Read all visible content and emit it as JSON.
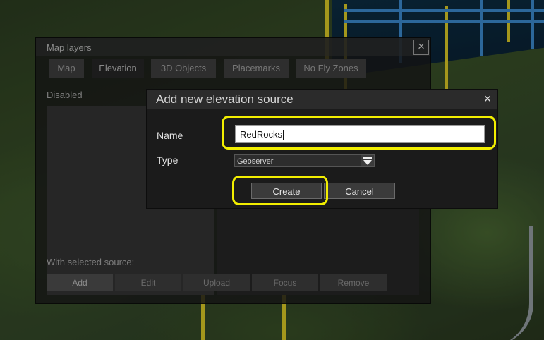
{
  "colors": {
    "highlight": "#f2ee00",
    "pole_yellow": "#e3d228",
    "pole_blue": "#3d8fd6"
  },
  "map_layers": {
    "title": "Map layers",
    "close_icon": "×",
    "tabs": [
      {
        "label": "Map",
        "active": false
      },
      {
        "label": "Elevation",
        "active": true
      },
      {
        "label": "3D Objects",
        "active": false
      },
      {
        "label": "Placemarks",
        "active": false
      },
      {
        "label": "No Fly Zones",
        "active": false
      }
    ],
    "disabled_label": "Disabled",
    "with_selected_label": "With selected source:",
    "buttons": [
      {
        "label": "Add",
        "enabled": true
      },
      {
        "label": "Edit",
        "enabled": false
      },
      {
        "label": "Upload",
        "enabled": false
      },
      {
        "label": "Focus",
        "enabled": false
      },
      {
        "label": "Remove",
        "enabled": false
      }
    ]
  },
  "dialog": {
    "title": "Add new elevation source",
    "close_icon": "×",
    "name_label": "Name",
    "name_value": "RedRocks",
    "type_label": "Type",
    "type_value": "Geoserver",
    "create_label": "Create",
    "cancel_label": "Cancel"
  }
}
